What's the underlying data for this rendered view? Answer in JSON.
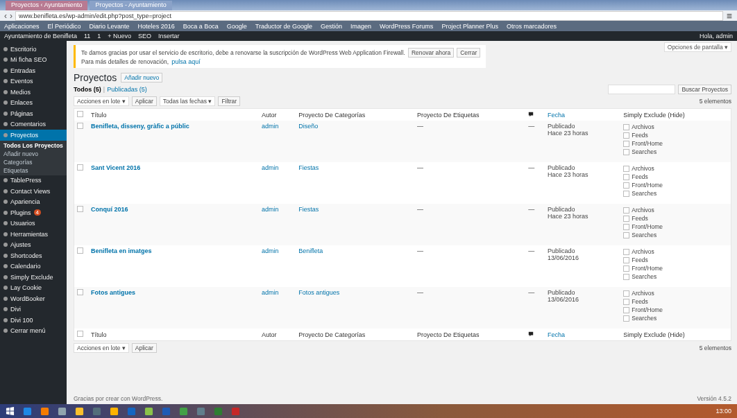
{
  "browser": {
    "tabs": [
      {
        "title": "Proyectos ‹ Ayuntamiento",
        "selected": true
      },
      {
        "title": "Proyectos - Ayuntamiento",
        "selected": false
      }
    ],
    "back": "‹",
    "forward": "›",
    "url": "www.benifleta.es/wp-admin/edit.php?post_type=project",
    "bookmarks": [
      "Aplicaciones",
      "El Periódico",
      "Diario Levante",
      "Hoteles 2016",
      "Boca a Boca",
      "Google",
      "Traductor de Google",
      "Gestión",
      "Imagen",
      "WordPress Forums",
      "Project Planner Plus",
      "Otros marcadores"
    ]
  },
  "admin_bar": {
    "site": "Ayuntamiento de Benifleta",
    "updates": "11",
    "comments": "1",
    "new": "+ Nuevo",
    "seo": "SEO",
    "insert": "Insertar",
    "greeting": "Hola, admin"
  },
  "sidebar": {
    "items": [
      {
        "label": "Escritorio",
        "selected": false
      },
      {
        "label": "Mi ficha SEO",
        "selected": false
      },
      {
        "label": "Entradas",
        "selected": false
      },
      {
        "label": "Eventos",
        "selected": false
      },
      {
        "label": "Medios",
        "selected": false
      },
      {
        "label": "Enlaces",
        "selected": false
      },
      {
        "label": "Páginas",
        "selected": false
      },
      {
        "label": "Comentarios",
        "selected": false
      },
      {
        "label": "Proyectos",
        "selected": true,
        "children": [
          {
            "label": "Todos Los Proyectos",
            "selected": true
          },
          {
            "label": "Añadir nuevo",
            "selected": false
          },
          {
            "label": "Categorías",
            "selected": false
          },
          {
            "label": "Etiquetas",
            "selected": false
          }
        ]
      },
      {
        "label": "TablePress",
        "selected": false
      },
      {
        "label": "Contact Views",
        "selected": false
      },
      {
        "label": "Apariencia",
        "selected": false
      },
      {
        "label": "Plugins",
        "selected": false,
        "badge": "4"
      },
      {
        "label": "Usuarios",
        "selected": false
      },
      {
        "label": "Herramientas",
        "selected": false
      },
      {
        "label": "Ajustes",
        "selected": false
      },
      {
        "label": "Shortcodes",
        "selected": false
      },
      {
        "label": "Calendario",
        "selected": false
      },
      {
        "label": "Simply Exclude",
        "selected": false
      },
      {
        "label": "Lay Cookie",
        "selected": false
      },
      {
        "label": "WordBooker",
        "selected": false
      },
      {
        "label": "Divi",
        "selected": false
      },
      {
        "label": "Divi 100",
        "selected": false
      },
      {
        "label": "Cerrar menú",
        "selected": false
      }
    ]
  },
  "screen_options": "Opciones de pantalla ▾",
  "notice": {
    "text": "Te damos gracias por usar el servicio de escritorio, debe a renovarse la suscripción de WordPress Web Application Firewall.",
    "button1": "Renovar ahora",
    "button2": "Cerrar",
    "text2": "Para más detalles de renovación,",
    "link": "pulsa aquí"
  },
  "page": {
    "title": "Proyectos",
    "add_new": "Añadir nuevo",
    "views": [
      {
        "label": "Todos (5)",
        "selected": true
      },
      {
        "label": "Publicadas (5)",
        "selected": false
      }
    ],
    "view_separator": "|",
    "bulk": "Acciones en lote ▾",
    "apply": "Aplicar",
    "dates": "Todas las fechas ▾",
    "filter": "Filtrar",
    "search_button": "Buscar Proyectos",
    "count": "5 elementos"
  },
  "table": {
    "select_all_checked": false,
    "columns": [
      "Título",
      "Autor",
      "Proyecto De Categorías",
      "Proyecto De Etiquetas",
      "",
      "Fecha",
      "Simply Exclude (Hide)"
    ],
    "rows": [
      {
        "selected": false,
        "title": "Benifleta, disseny, gràfic a públic",
        "author": "admin",
        "category": "Diseño",
        "tags": "—",
        "comments": "—",
        "status": "Publicado",
        "date": "Hace 23 horas",
        "exclude": [
          {
            "label": "Archivos",
            "checked": false
          },
          {
            "label": "Feeds",
            "checked": false
          },
          {
            "label": "Front/Home",
            "checked": false
          },
          {
            "label": "Searches",
            "checked": false
          }
        ]
      },
      {
        "selected": false,
        "title": "Sant Vicent 2016",
        "author": "admin",
        "category": "Fiestas",
        "tags": "—",
        "comments": "—",
        "status": "Publicado",
        "date": "Hace 23 horas",
        "exclude": [
          {
            "label": "Archivos",
            "checked": false
          },
          {
            "label": "Feeds",
            "checked": false
          },
          {
            "label": "Front/Home",
            "checked": false
          },
          {
            "label": "Searches",
            "checked": false
          }
        ]
      },
      {
        "selected": false,
        "title": "Conquí 2016",
        "author": "admin",
        "category": "Fiestas",
        "tags": "—",
        "comments": "—",
        "status": "Publicado",
        "date": "Hace 23 horas",
        "exclude": [
          {
            "label": "Archivos",
            "checked": false
          },
          {
            "label": "Feeds",
            "checked": false
          },
          {
            "label": "Front/Home",
            "checked": false
          },
          {
            "label": "Searches",
            "checked": false
          }
        ]
      },
      {
        "selected": false,
        "title": "Benifleta en imatges",
        "author": "admin",
        "category": "Benifleta",
        "tags": "—",
        "comments": "—",
        "status": "Publicado",
        "date": "13/06/2016",
        "exclude": [
          {
            "label": "Archivos",
            "checked": false
          },
          {
            "label": "Feeds",
            "checked": false
          },
          {
            "label": "Front/Home",
            "checked": false
          },
          {
            "label": "Searches",
            "checked": false
          }
        ]
      },
      {
        "selected": false,
        "title": "Fotos antigues",
        "author": "admin",
        "category": "Fotos antigues",
        "tags": "—",
        "comments": "—",
        "status": "Publicado",
        "date": "13/06/2016",
        "exclude": [
          {
            "label": "Archivos",
            "checked": false
          },
          {
            "label": "Feeds",
            "checked": false
          },
          {
            "label": "Front/Home",
            "checked": false
          },
          {
            "label": "Searches",
            "checked": false
          }
        ]
      }
    ],
    "footer_checked": false,
    "footer_columns": [
      "Título",
      "Autor",
      "Proyecto De Categorías",
      "Proyecto De Etiquetas",
      "",
      "Fecha",
      "Simply Exclude (Hide)"
    ]
  },
  "bottom_actions": {
    "bulk": "Acciones en lote ▾",
    "apply": "Aplicar",
    "count": "5 elementos"
  },
  "footer": {
    "thanks": "Gracias por crear con WordPress.",
    "version": "Versión 4.5.2"
  },
  "taskbar": {
    "time": "13:00"
  }
}
